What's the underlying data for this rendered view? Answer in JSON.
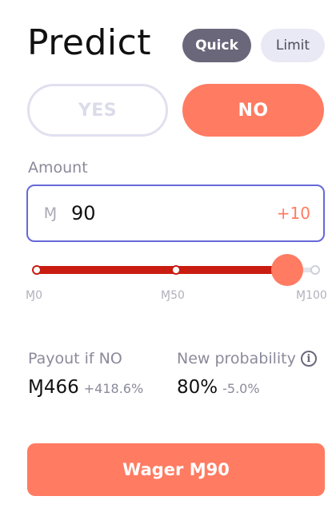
{
  "header": {
    "title": "Predict",
    "modes": [
      "Quick",
      "Limit"
    ],
    "active_mode": "Quick"
  },
  "outcome": {
    "yes_label": "YES",
    "no_label": "NO",
    "selected": "NO"
  },
  "amount": {
    "label": "Amount",
    "currency_symbol": "Ɱ",
    "value": "90",
    "increment_label": "+10"
  },
  "slider": {
    "min_label": "Ɱ0",
    "mid_label": "Ɱ50",
    "max_label": "Ɱ100",
    "min": 0,
    "max": 100,
    "value": 90
  },
  "stats": {
    "payout_label": "Payout if NO",
    "payout_value": "Ɱ466",
    "payout_delta": "+418.6%",
    "probability_label": "New probability",
    "probability_value": "80%",
    "probability_delta": "-5.0%"
  },
  "submit": {
    "label": "Wager Ɱ90"
  },
  "colors": {
    "accent_no": "#ff7b62",
    "slider_fill": "#c91d12",
    "input_border": "#6569d8",
    "active_pill": "#6b677b"
  },
  "icons": {
    "currency": "mana-icon",
    "info": "info-icon"
  }
}
